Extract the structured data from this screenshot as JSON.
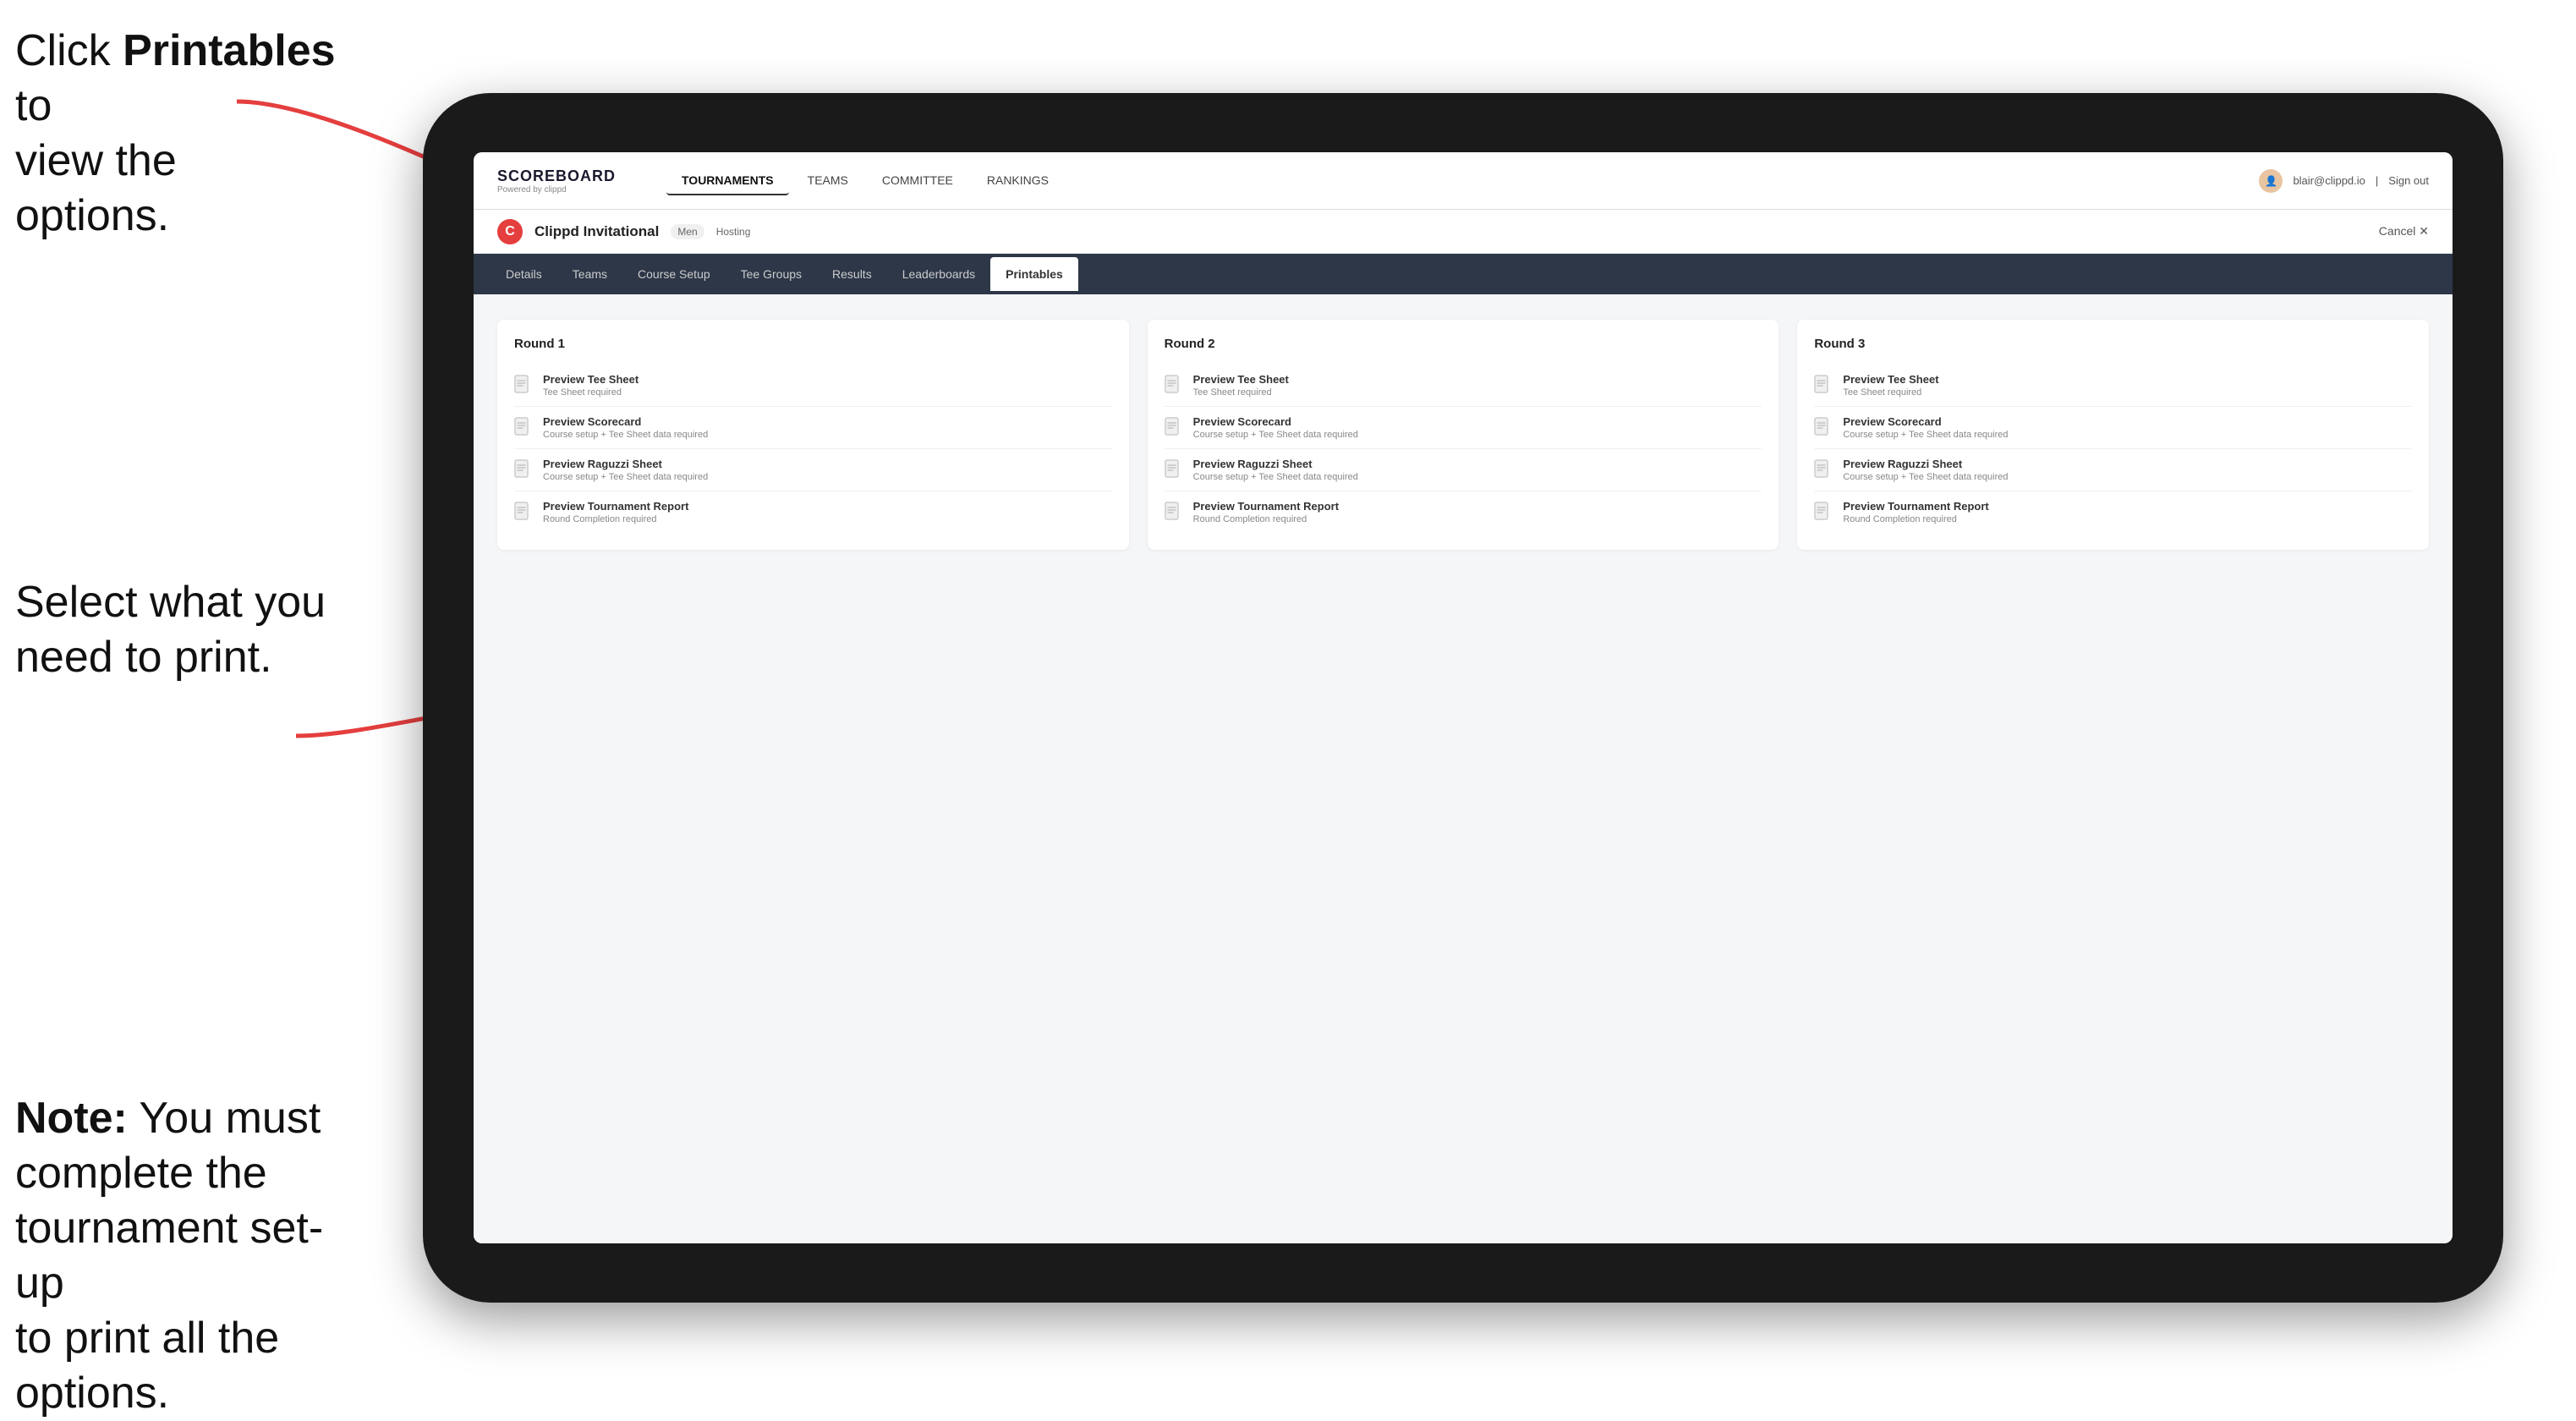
{
  "instructions": {
    "top_line1": "Click ",
    "top_bold": "Printables",
    "top_line2": " to",
    "top_line3": "view the options.",
    "middle": "Select what you\nneed to print.",
    "bottom_bold": "Note:",
    "bottom_text": " You must\ncomplete the\ntournament set-up\nto print all the options."
  },
  "nav": {
    "brand": "SCOREBOARD",
    "brand_sub": "Powered by clippd",
    "links": [
      "TOURNAMENTS",
      "TEAMS",
      "COMMITTEE",
      "RANKINGS"
    ],
    "user_email": "blair@clippd.io",
    "sign_out": "Sign out"
  },
  "tournament": {
    "logo_letter": "C",
    "name": "Clippd Invitational",
    "gender_badge": "Men",
    "hosting": "Hosting",
    "cancel": "Cancel ✕"
  },
  "sub_tabs": [
    "Details",
    "Teams",
    "Course Setup",
    "Tee Groups",
    "Results",
    "Leaderboards",
    "Printables"
  ],
  "active_tab": "Printables",
  "rounds": [
    {
      "title": "Round 1",
      "items": [
        {
          "title": "Preview Tee Sheet",
          "sub": "Tee Sheet required"
        },
        {
          "title": "Preview Scorecard",
          "sub": "Course setup + Tee Sheet data required"
        },
        {
          "title": "Preview Raguzzi Sheet",
          "sub": "Course setup + Tee Sheet data required"
        },
        {
          "title": "Preview Tournament Report",
          "sub": "Round Completion required"
        }
      ]
    },
    {
      "title": "Round 2",
      "items": [
        {
          "title": "Preview Tee Sheet",
          "sub": "Tee Sheet required"
        },
        {
          "title": "Preview Scorecard",
          "sub": "Course setup + Tee Sheet data required"
        },
        {
          "title": "Preview Raguzzi Sheet",
          "sub": "Course setup + Tee Sheet data required"
        },
        {
          "title": "Preview Tournament Report",
          "sub": "Round Completion required"
        }
      ]
    },
    {
      "title": "Round 3",
      "items": [
        {
          "title": "Preview Tee Sheet",
          "sub": "Tee Sheet required"
        },
        {
          "title": "Preview Scorecard",
          "sub": "Course setup + Tee Sheet data required"
        },
        {
          "title": "Preview Raguzzi Sheet",
          "sub": "Course setup + Tee Sheet data required"
        },
        {
          "title": "Preview Tournament Report",
          "sub": "Round Completion required"
        }
      ]
    }
  ]
}
